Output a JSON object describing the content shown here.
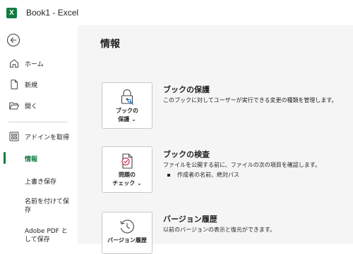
{
  "window": {
    "title": "Book1  -  Excel",
    "app_badge": "X",
    "accent": "#107c41"
  },
  "sidebar": {
    "back_icon": "back-arrow-icon",
    "items": [
      {
        "label": "ホーム",
        "icon": "home-icon"
      },
      {
        "label": "新規",
        "icon": "new-file-icon"
      },
      {
        "label": "開く",
        "icon": "folder-open-icon"
      },
      {
        "label": "アドインを取得",
        "icon": "add-ins-icon"
      },
      {
        "label": "情報",
        "active": true
      },
      {
        "label": "上書き保存"
      },
      {
        "label": "名前を付けて保存"
      },
      {
        "label": "Adobe PDF として保存"
      }
    ]
  },
  "main": {
    "title": "情報",
    "sections": [
      {
        "button_line1": "ブックの",
        "button_line2": "保護 ⌄",
        "icon": "lock-key-icon",
        "title": "ブックの保護",
        "desc": "このブックに対してユーザーが実行できる変更の種類を管理します。"
      },
      {
        "button_line1": "問題の",
        "button_line2": "チェック ⌄",
        "icon": "document-check-icon",
        "title": "ブックの検査",
        "desc": "ファイルを公開する前に、ファイルの次の項目を確認します。",
        "bullets": [
          "作成者の名前、絶対パス"
        ]
      },
      {
        "button_line1": "バージョン履歴",
        "button_line2": "",
        "icon": "history-clock-icon",
        "title": "バージョン履歴",
        "desc": "以前のバージョンの表示と復元ができます。"
      }
    ]
  }
}
